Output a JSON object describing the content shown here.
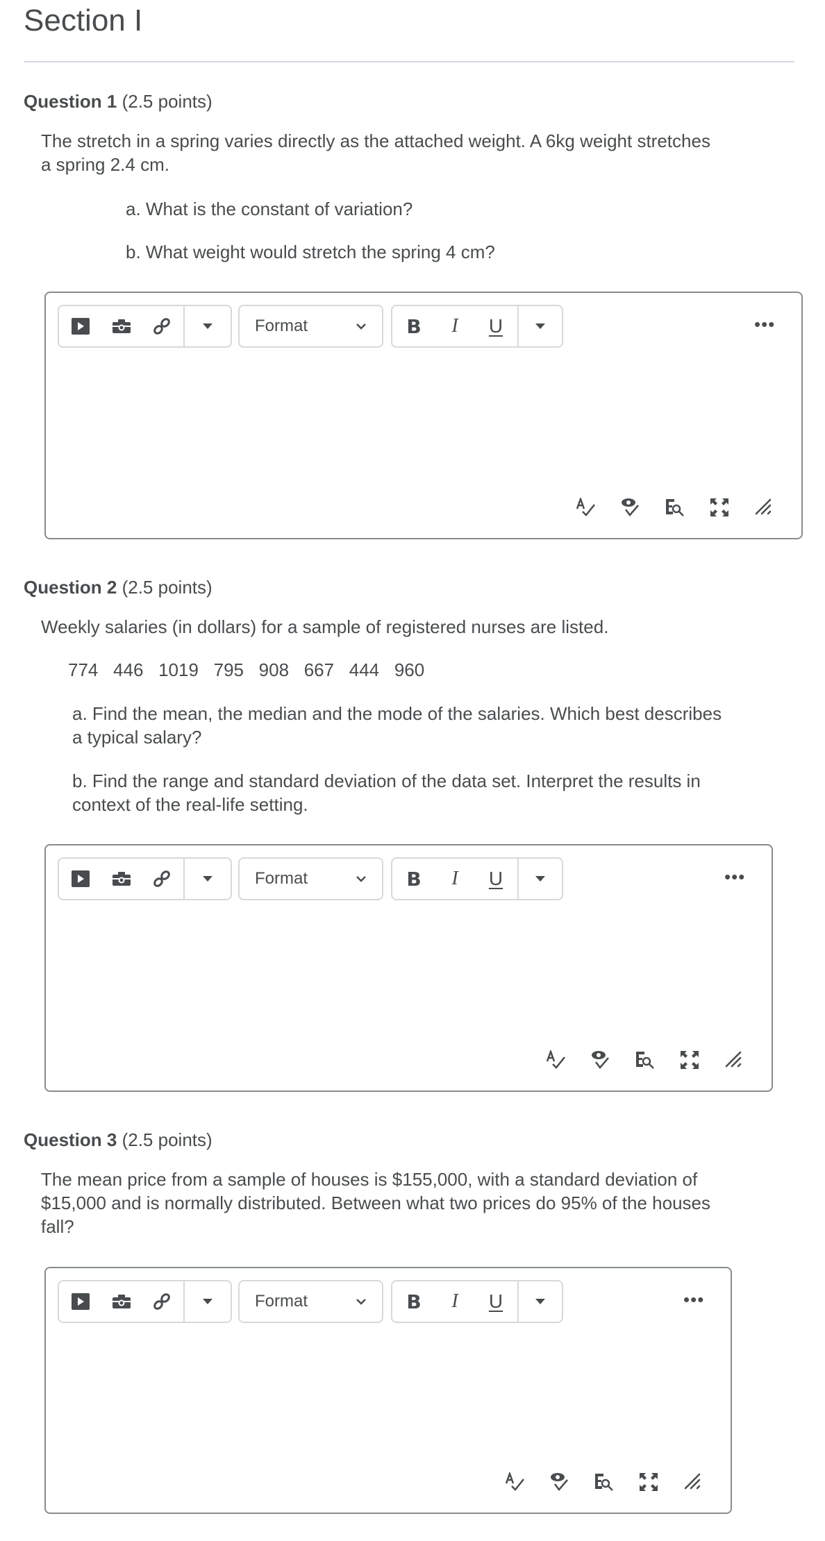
{
  "section": {
    "title": "Section I"
  },
  "editor_toolbar": {
    "insert_video_icon": "video-play-icon",
    "insert_image_icon": "camera-icon",
    "insert_link_icon": "link-icon",
    "insert_more_icon": "caret-down-icon",
    "format_label": "Format",
    "bold_label": "B",
    "italic_label": "I",
    "underline_label": "U",
    "more_label": "•••",
    "status_icons": [
      "spellcheck-icon",
      "accessibility-check-icon",
      "find-replace-icon",
      "fullscreen-icon",
      "resize-handle-icon"
    ]
  },
  "questions": [
    {
      "number_label": "Question 1",
      "points_label": "(2.5 points)",
      "body_lines": [
        "The stretch in a spring varies directly as the attached weight.  A 6kg weight stretches",
        "a spring 2.4 cm."
      ],
      "parts": [
        "a. What is the constant of variation?",
        "b. What weight would stretch the spring 4 cm?"
      ]
    },
    {
      "number_label": "Question 2",
      "points_label": "(2.5 points)",
      "body_lines": [
        "Weekly salaries (in dollars) for a sample of registered nurses are listed."
      ],
      "data_values": "774   446   1019   795   908   667   444   960",
      "parts_multiline": [
        [
          "a. Find the mean, the median and the mode of the salaries.  Which best describes",
          "a typical salary?"
        ],
        [
          "b. Find the range and standard deviation of the data set.  Interpret the results in",
          "context of the real-life setting."
        ]
      ]
    },
    {
      "number_label": "Question 3",
      "points_label": "(2.5 points)",
      "body_lines": [
        "The mean price from a sample of houses is $155,000, with a standard deviation of",
        "$15,000 and is normally distributed. Between what two prices do 95% of the houses",
        "fall?"
      ]
    }
  ]
}
